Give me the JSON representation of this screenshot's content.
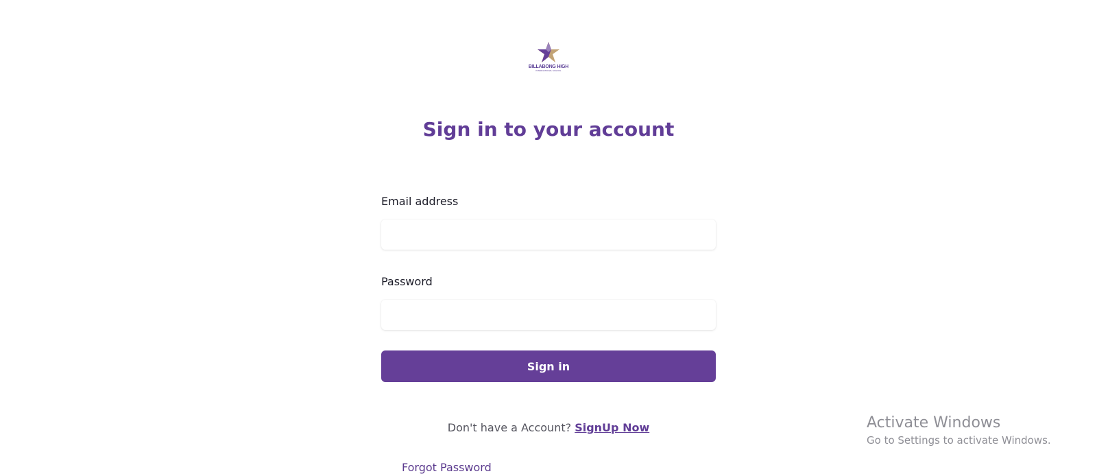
{
  "brand": {
    "name": "BILLABONG HIGH",
    "tagline": "INTERNATIONAL SCHOOL",
    "colors": {
      "primary": "#653f98",
      "gold": "#f2b733",
      "grey": "#9a93ad"
    }
  },
  "heading": "Sign in to your account",
  "form": {
    "email_label": "Email address",
    "email_value": "",
    "password_label": "Password",
    "password_value": "",
    "submit_label": "Sign in"
  },
  "signup": {
    "prompt": "Don't have a Account?",
    "link_label": "SignUp Now"
  },
  "forgot_label": "Forgot Password",
  "watermark": {
    "title": "Activate Windows",
    "subtitle": "Go to Settings to activate Windows."
  }
}
